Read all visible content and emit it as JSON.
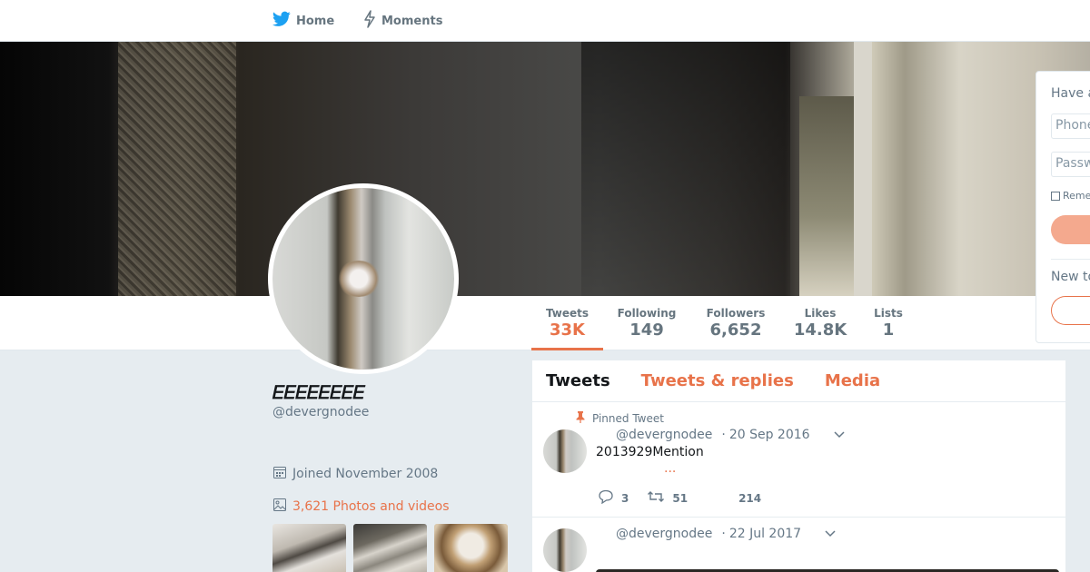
{
  "nav": {
    "home_label": "Home",
    "moments_label": "Moments"
  },
  "stats": [
    {
      "label": "Tweets",
      "value": "33K"
    },
    {
      "label": "Following",
      "value": "149"
    },
    {
      "label": "Followers",
      "value": "6,652"
    },
    {
      "label": "Likes",
      "value": "14.8K"
    },
    {
      "label": "Lists",
      "value": "1"
    }
  ],
  "profile": {
    "name": "𝐸𝐸𝐸𝐸𝐸𝐸𝐸𝐸",
    "handle": "@devergnodee",
    "joined": "Joined November 2008",
    "photos_link": "3,621 Photos and videos"
  },
  "timeline": {
    "tabs": [
      {
        "label": "Tweets"
      },
      {
        "label": "Tweets & replies"
      },
      {
        "label": "Media"
      }
    ],
    "tweets": [
      {
        "pinned_label": "Pinned Tweet",
        "handle": "@devergnodee",
        "date": "20 Sep 2016",
        "text": "2013929Mention",
        "ellipsis": "...",
        "replies": "3",
        "retweets": "51",
        "likes": "214"
      },
      {
        "handle": "@devergnodee",
        "date": "22 Jul 2017"
      }
    ]
  },
  "login": {
    "title": "Have a",
    "phone_placeholder": "Phone",
    "password_placeholder": "Passw",
    "remember_label": "Reme",
    "signup_title": "New to"
  },
  "colors": {
    "accent": "#e8734a",
    "background": "#e6ecf0",
    "twitter_blue": "#1da1f2"
  }
}
